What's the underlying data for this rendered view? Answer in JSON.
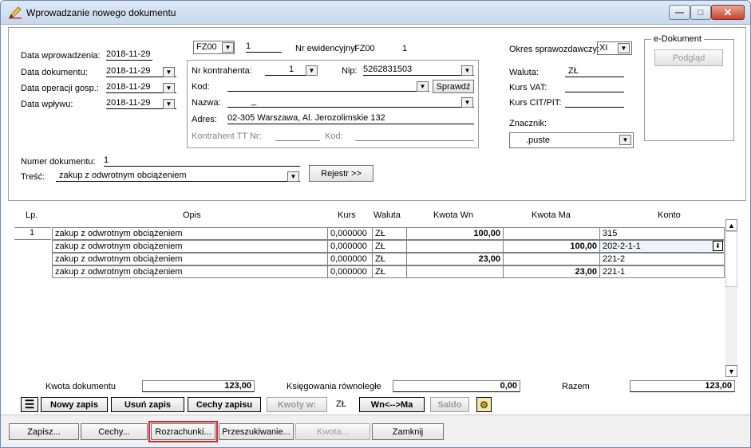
{
  "window": {
    "title": "Wprowadzanie nowego dokumentu"
  },
  "header": {
    "data_wprowadzenia_label": "Data wprowadzenia:",
    "data_wprowadzenia": "2018-11-29",
    "data_dokumentu_label": "Data dokumentu:",
    "data_dokumentu": "2018-11-29",
    "data_operacji_label": "Data operacji gosp.:",
    "data_operacji": "2018-11-29",
    "data_wplywu_label": "Data wpływu:",
    "data_wplywu": "2018-11-29",
    "doc_type": "FZ00",
    "doc_number": "1",
    "nr_ewidencyjny_label": "Nr ewidencyjny:",
    "nr_ewidencyjny_code": "FZ00",
    "nr_ewidencyjny_number": "1",
    "okres_label": "Okres sprawozdawczy:",
    "okres_value": "XI",
    "waluta_label": "Waluta:",
    "waluta_value": "ZŁ",
    "kurs_vat_label": "Kurs VAT:",
    "kurs_cit_label": "Kurs CIT/PIT:",
    "znacznik_label": "Znacznik:",
    "znacznik_value": ".puste",
    "edokument_title": "e-Dokument",
    "podglad_label": "Podgląd",
    "numer_dokumentu_label": "Numer dokumentu:",
    "numer_dokumentu": "1",
    "tresc_label": "Treść:",
    "tresc_value": "zakup z odwrotnym obciążeniem",
    "rejestr_label": "Rejestr >>"
  },
  "kontrahent": {
    "nr_label": "Nr kontrahenta:",
    "nr_value": "1",
    "nip_label": "Nip:",
    "nip_value": "5262831503",
    "kod_label": "Kod:",
    "sprawdz_label": "Sprawdź",
    "nazwa_label": "Nazwa:",
    "nazwa_value": "_",
    "adres_label": "Adres:",
    "adres_value": "02-305 Warszawa, Al. Jerozolimskie 132",
    "tt_label": "Kontrahent TT Nr:",
    "tt_kod_label": "Kod:"
  },
  "grid": {
    "headers": [
      "Lp.",
      "Opis",
      "Kurs",
      "Waluta",
      "Kwota Wn",
      "Kwota Ma",
      "Konto"
    ],
    "rows": [
      {
        "lp": "1",
        "opis": "zakup z odwrotnym obciążeniem",
        "kurs": "0,000000",
        "waluta": "ZŁ",
        "wn": "100,00",
        "ma": "",
        "konto": "315"
      },
      {
        "lp": "",
        "opis": "zakup z odwrotnym obciążeniem",
        "kurs": "0,000000",
        "waluta": "ZŁ",
        "wn": "",
        "ma": "100,00",
        "konto": "202-2-1-1"
      },
      {
        "lp": "",
        "opis": "zakup z odwrotnym obciążeniem",
        "kurs": "0,000000",
        "waluta": "ZŁ",
        "wn": "23,00",
        "ma": "",
        "konto": "221-2"
      },
      {
        "lp": "",
        "opis": "zakup z odwrotnym obciążeniem",
        "kurs": "0,000000",
        "waluta": "ZŁ",
        "wn": "",
        "ma": "23,00",
        "konto": "221-1"
      }
    ]
  },
  "totals": {
    "kwota_dokumentu_label": "Kwota dokumentu",
    "kwota_dokumentu": "123,00",
    "ksiegowania_label": "Księgowania równoległe",
    "ksiegowania_value": "0,00",
    "razem_label": "Razem",
    "razem_value": "123,00"
  },
  "toolbar": {
    "nowy_zapis": "Nowy zapis",
    "usun_zapis": "Usuń zapis",
    "cechy_zapisu": "Cechy zapisu",
    "kwoty_w": "Kwoty w:",
    "currency": "ZŁ",
    "wn_ma": "Wn<-->Ma",
    "saldo": "Saldo"
  },
  "bottom": {
    "zapisz": "Zapisz...",
    "cechy": "Cechy...",
    "rozrachunki": "Rozrachunki...",
    "przeszukiwanie": "Przeszukiwanie...",
    "kwota": "Kwota...",
    "zamknij": "Zamknij"
  }
}
